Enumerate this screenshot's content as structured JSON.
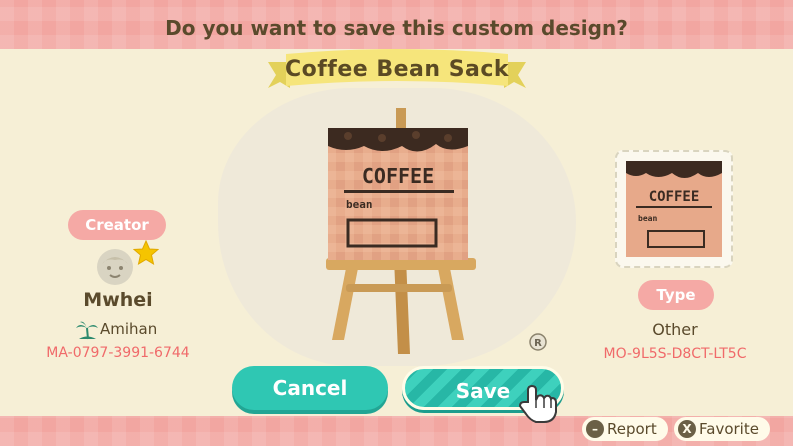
{
  "prompt": "Do you want to save this custom design?",
  "design": {
    "title": "Coffee Bean Sack",
    "art_text_line1": "COFFEE",
    "art_text_line2": "bean"
  },
  "creator": {
    "section_label": "Creator",
    "name": "Mwhei",
    "island": "Amihan",
    "code": "MA-0797-3991-6744"
  },
  "type": {
    "section_label": "Type",
    "value": "Other",
    "design_code": "MO-9L5S-D8CT-LT5C"
  },
  "buttons": {
    "cancel": "Cancel",
    "save": "Save"
  },
  "hints": [
    {
      "key": "–",
      "label": "Report"
    },
    {
      "key": "X",
      "label": "Favorite"
    }
  ],
  "colors": {
    "background": "#f6efd6",
    "band": "#f2a6a1",
    "teal": "#2fc7b3",
    "code_red": "#f06a6a",
    "text": "#5a4a2c"
  }
}
